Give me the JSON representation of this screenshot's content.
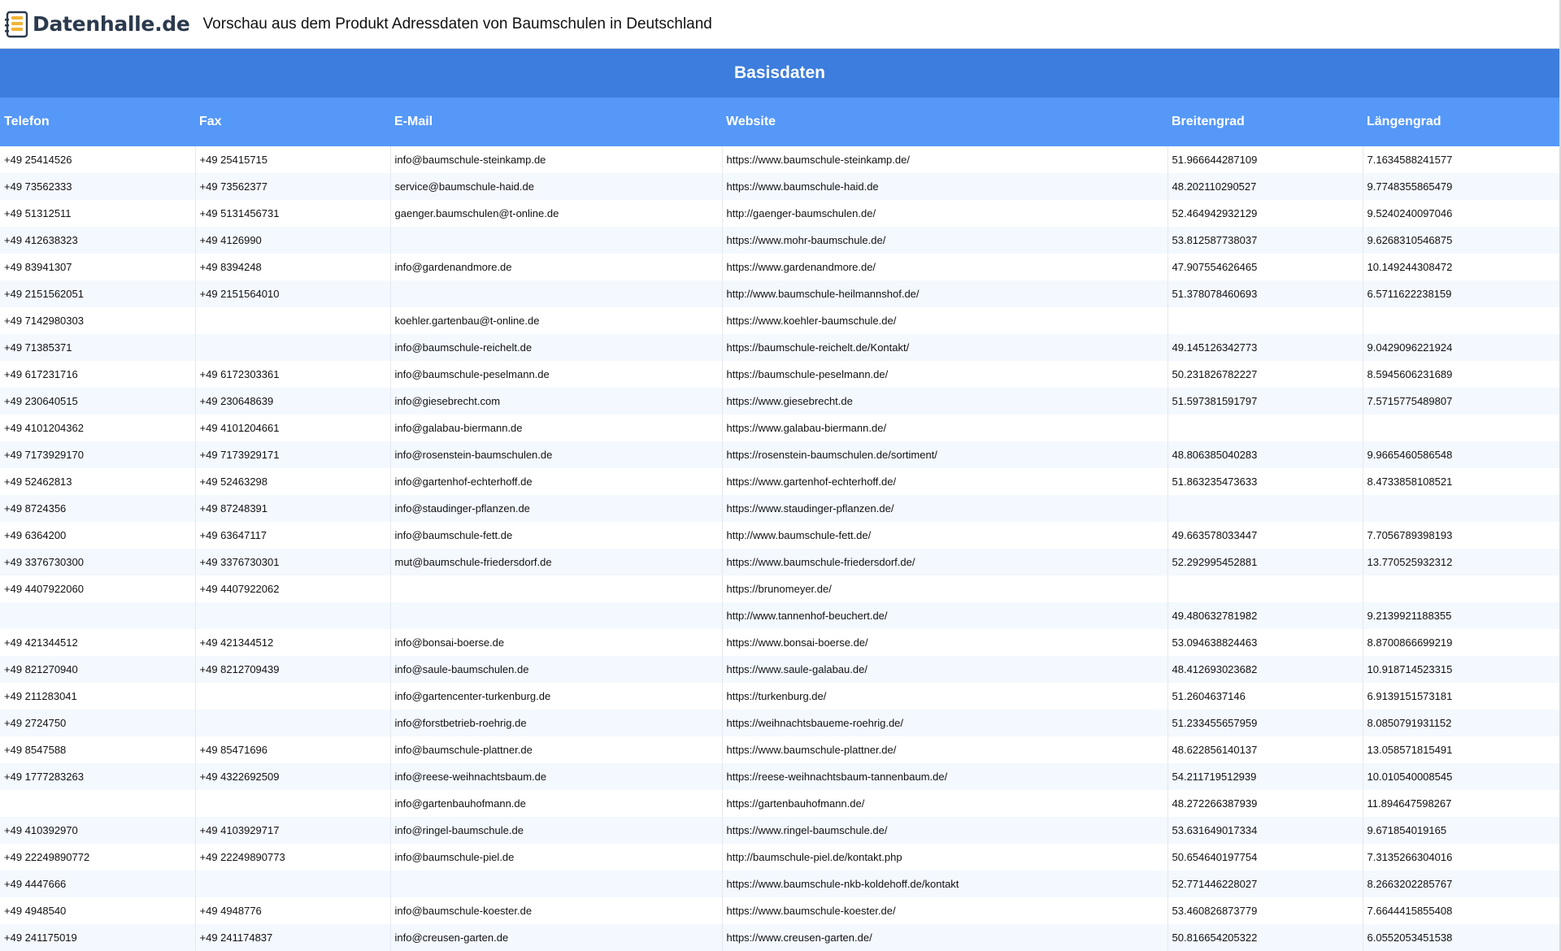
{
  "brand": {
    "name": "Datenhalle.de"
  },
  "page": {
    "title": "Vorschau aus dem Produkt Adressdaten von Baumschulen in Deutschland"
  },
  "section": {
    "title": "Basisdaten"
  },
  "table": {
    "columns": [
      "Telefon",
      "Fax",
      "E-Mail",
      "Website",
      "Breitengrad",
      "Längengrad"
    ],
    "rows": [
      [
        "+49 25414526",
        "+49 25415715",
        "info@baumschule-steinkamp.de",
        "https://www.baumschule-steinkamp.de/",
        "51.966644287109",
        "7.1634588241577"
      ],
      [
        "+49 73562333",
        "+49 73562377",
        "service@baumschule-haid.de",
        "https://www.baumschule-haid.de",
        "48.202110290527",
        "9.7748355865479"
      ],
      [
        "+49 51312511",
        "+49 5131456731",
        "gaenger.baumschulen@t-online.de",
        "http://gaenger-baumschulen.de/",
        "52.464942932129",
        "9.5240240097046"
      ],
      [
        "+49 412638323",
        "+49 4126990",
        "",
        "https://www.mohr-baumschule.de/",
        "53.812587738037",
        "9.6268310546875"
      ],
      [
        "+49 83941307",
        "+49 8394248",
        "info@gardenandmore.de",
        "https://www.gardenandmore.de/",
        "47.907554626465",
        "10.149244308472"
      ],
      [
        "+49 2151562051",
        "+49 2151564010",
        "",
        "http://www.baumschule-heilmannshof.de/",
        "51.378078460693",
        "6.5711622238159"
      ],
      [
        "+49 7142980303",
        "",
        "koehler.gartenbau@t-online.de",
        "https://www.koehler-baumschule.de/",
        "",
        ""
      ],
      [
        "+49 71385371",
        "",
        "info@baumschule-reichelt.de",
        "https://baumschule-reichelt.de/Kontakt/",
        "49.145126342773",
        "9.0429096221924"
      ],
      [
        "+49 617231716",
        "+49 6172303361",
        "info@baumschule-peselmann.de",
        "https://baumschule-peselmann.de/",
        "50.231826782227",
        "8.5945606231689"
      ],
      [
        "+49 230640515",
        "+49 230648639",
        "info@giesebrecht.com",
        "https://www.giesebrecht.de",
        "51.597381591797",
        "7.5715775489807"
      ],
      [
        "+49 4101204362",
        "+49 4101204661",
        "info@galabau-biermann.de",
        "https://www.galabau-biermann.de/",
        "",
        ""
      ],
      [
        "+49 7173929170",
        "+49 7173929171",
        "info@rosenstein-baumschulen.de",
        "https://rosenstein-baumschulen.de/sortiment/",
        "48.806385040283",
        "9.9665460586548"
      ],
      [
        "+49 52462813",
        "+49 52463298",
        "info@gartenhof-echterhoff.de",
        "https://www.gartenhof-echterhoff.de/",
        "51.863235473633",
        "8.4733858108521"
      ],
      [
        "+49 8724356",
        "+49 87248391",
        "info@staudinger-pflanzen.de",
        "https://www.staudinger-pflanzen.de/",
        "",
        ""
      ],
      [
        "+49 6364200",
        "+49 63647117",
        "info@baumschule-fett.de",
        "http://www.baumschule-fett.de/",
        "49.663578033447",
        "7.7056789398193"
      ],
      [
        "+49 3376730300",
        "+49 3376730301",
        "mut@baumschule-friedersdorf.de",
        "https://www.baumschule-friedersdorf.de/",
        "52.292995452881",
        "13.770525932312"
      ],
      [
        "+49 4407922060",
        "+49 4407922062",
        "",
        "https://brunomeyer.de/",
        "",
        ""
      ],
      [
        "",
        "",
        "",
        "http://www.tannenhof-beuchert.de/",
        "49.480632781982",
        "9.2139921188355"
      ],
      [
        "+49 421344512",
        "+49 421344512",
        "info@bonsai-boerse.de",
        "https://www.bonsai-boerse.de/",
        "53.094638824463",
        "8.8700866699219"
      ],
      [
        "+49 821270940",
        "+49 8212709439",
        "info@saule-baumschulen.de",
        "https://www.saule-galabau.de/",
        "48.412693023682",
        "10.918714523315"
      ],
      [
        "+49 211283041",
        "",
        "info@gartencenter-turkenburg.de",
        "https://turkenburg.de/",
        "51.2604637146",
        "6.9139151573181"
      ],
      [
        "+49 2724750",
        "",
        "info@forstbetrieb-roehrig.de",
        "https://weihnachtsbaueme-roehrig.de/",
        "51.233455657959",
        "8.0850791931152"
      ],
      [
        "+49 8547588",
        "+49 85471696",
        "info@baumschule-plattner.de",
        "https://www.baumschule-plattner.de/",
        "48.622856140137",
        "13.058571815491"
      ],
      [
        "+49 1777283263",
        "+49 4322692509",
        "info@reese-weihnachtsbaum.de",
        "https://reese-weihnachtsbaum-tannenbaum.de/",
        "54.211719512939",
        "10.010540008545"
      ],
      [
        "",
        "",
        "info@gartenbauhofmann.de",
        "https://gartenbauhofmann.de/",
        "48.272266387939",
        "11.894647598267"
      ],
      [
        "+49 410392970",
        "+49 4103929717",
        "info@ringel-baumschule.de",
        "https://www.ringel-baumschule.de/",
        "53.631649017334",
        "9.671854019165"
      ],
      [
        "+49 22249890772",
        "+49 22249890773",
        "info@baumschule-piel.de",
        "http://baumschule-piel.de/kontakt.php",
        "50.654640197754",
        "7.3135266304016"
      ],
      [
        "+49 4447666",
        "",
        "",
        "https://www.baumschule-nkb-koldehoff.de/kontakt",
        "52.771446228027",
        "8.2663202285767"
      ],
      [
        "+49 4948540",
        "+49 4948776",
        "info@baumschule-koester.de",
        "https://www.baumschule-koester.de/",
        "53.460826873779",
        "7.6644415855408"
      ],
      [
        "+49 241175019",
        "+49 241174837",
        "info@creusen-garten.de",
        "https://www.creusen-garten.de/",
        "50.816654205322",
        "6.0552053451538"
      ]
    ]
  }
}
